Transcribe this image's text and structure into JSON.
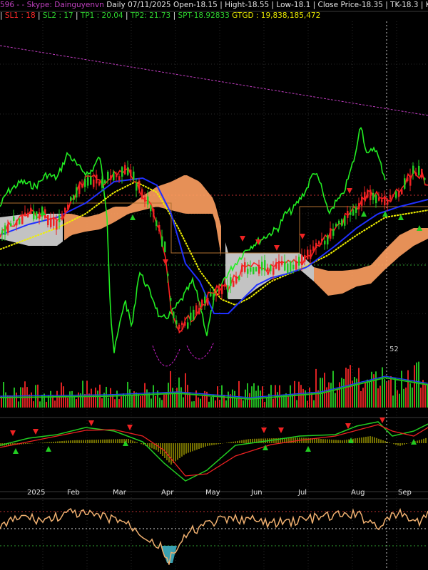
{
  "header": {
    "line1": {
      "id_fragment": "596",
      "skype_label": "- - Skype: Dainguyenvn",
      "daily": "Daily 07/11/2025",
      "open": "Open-18.15",
      "high": "| Hight-18.55",
      "low": "| Low-18.1",
      "close": "| Close Price-18.35",
      "tk": "| TK-18.3",
      "kj": "| KJ-18.1"
    },
    "line2": {
      "sep": "|",
      "sl1": "SL1 : 18",
      "sl2": "SL2 : 17",
      "tp1": "TP1 : 20.04",
      "tp2": "TP2: 21.73",
      "spt": "SPT-18.92833",
      "gtgd": "GTGD : 19,838,185,472"
    }
  },
  "price_label": "52",
  "months": [
    "2025",
    "Feb",
    "Mar",
    "Apr",
    "May",
    "Jun",
    "Jul",
    "Aug",
    "Sep"
  ],
  "colors": {
    "background": "#000000",
    "grid": "#2a2a2a",
    "candle_up": "#22cc22",
    "candle_down": "#ee2222",
    "tenkan": "#ff2020",
    "kijun": "#2030ff",
    "chikou": "#22ee22",
    "ma": "#f0f000",
    "cloud_bull": "#ffa060",
    "cloud_bear": "#d8d8d8",
    "trendline": "#c03cc0",
    "macd": "#22cc22",
    "signal": "#ee2222",
    "rsi": "#f0b070"
  },
  "chart_data": [
    {
      "type": "candlestick",
      "title": "",
      "x": [
        "Jan",
        "Feb",
        "Mar",
        "Apr",
        "May",
        "Jun",
        "Jul",
        "Aug",
        "Sep"
      ],
      "ohlc_last": {
        "date": "07/11/2025",
        "open": 18.15,
        "high": 18.55,
        "low": 18.1,
        "close": 18.35
      },
      "series": [
        {
          "name": "TK",
          "last": 18.3
        },
        {
          "name": "KJ",
          "last": 18.1
        }
      ],
      "levels": {
        "SL1": 18,
        "SL2": 17,
        "TP1": 20.04,
        "TP2": 21.73,
        "SPT": 18.92833
      },
      "volume_value": 19838185472,
      "grid": true
    },
    {
      "type": "bar",
      "title": "",
      "series": [
        {
          "name": "",
          "values": []
        }
      ]
    },
    {
      "type": "line",
      "title": "",
      "series": [
        {
          "name": "",
          "values": []
        }
      ]
    },
    {
      "type": "line",
      "title": "",
      "series": [
        {
          "name": "",
          "values": []
        }
      ]
    }
  ]
}
